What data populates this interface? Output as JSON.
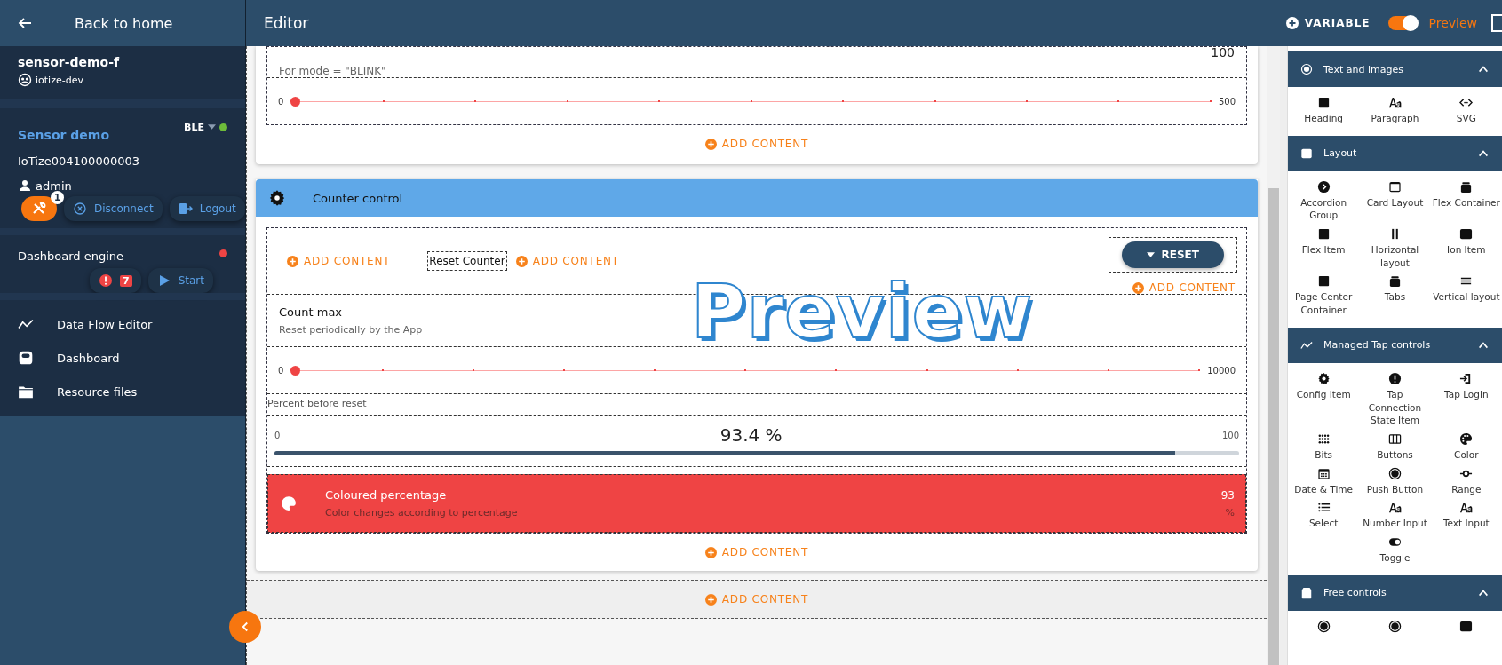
{
  "sidebar": {
    "back_label": "Back to home",
    "project": {
      "name": "sensor-demo-f",
      "organization": "iotize-dev"
    },
    "device": {
      "name": "Sensor demo",
      "protocol": "BLE",
      "connected": true,
      "serial": "IoTize004100000003",
      "user": "admin",
      "tools_badge": "1",
      "disconnect_label": "Disconnect",
      "logout_label": "Logout"
    },
    "engine": {
      "label": "Dashboard engine",
      "running": false,
      "error_count": "7",
      "start_label": "Start"
    },
    "nav": [
      {
        "kind": "chart",
        "label": "Data Flow Editor"
      },
      {
        "kind": "dashboard",
        "label": "Dashboard"
      },
      {
        "kind": "folder",
        "label": "Resource files"
      }
    ]
  },
  "header": {
    "title": "Editor",
    "variable_label": "VARIABLE",
    "preview_toggle": {
      "on": true,
      "label": "Preview"
    }
  },
  "editor": {
    "preview_overlay": "Preview",
    "top_card": {
      "subtitle": "For mode = \"BLINK\"",
      "value": "100",
      "slider": {
        "min": "0",
        "max": "500",
        "level": 0
      },
      "add_label": "ADD CONTENT"
    },
    "counter_card": {
      "title": "Counter control",
      "row": {
        "add_label_1": "ADD CONTENT",
        "text": "Reset Counter",
        "add_label_2": "ADD CONTENT",
        "button": "RESET",
        "button_add_label": "ADD CONTENT"
      },
      "count_max": {
        "title": "Count max",
        "description": "Reset periodically by the App",
        "slider": {
          "min": "0",
          "max": "10000",
          "level": 0
        }
      },
      "percent_label": "Percent before reset",
      "progress": {
        "min": "0",
        "max": "100",
        "reading": "93.4 %",
        "level": 0.934
      },
      "coloured": {
        "title": "Coloured percentage",
        "description": "Color changes according to percentage",
        "value": "93",
        "unit": "%"
      },
      "add_label": "ADD CONTENT"
    },
    "outer_add_label": "ADD CONTENT"
  },
  "panel": {
    "sections": [
      {
        "kind": "target",
        "title": "Text and images",
        "expanded": true,
        "items": [
          {
            "kind": "square",
            "label": "Heading"
          },
          {
            "kind": "aa",
            "label": "Paragraph"
          },
          {
            "kind": "code",
            "label": "SVG"
          }
        ]
      },
      {
        "kind": "card",
        "title": "Layout",
        "expanded": true,
        "items": [
          {
            "kind": "chevron",
            "label": "Accordion Group"
          },
          {
            "kind": "card",
            "label": "Card Layout"
          },
          {
            "kind": "stack",
            "label": "Flex Container"
          },
          {
            "kind": "square",
            "label": "Flex Item"
          },
          {
            "kind": "pause",
            "label": "Horizontal layout"
          },
          {
            "kind": "monitor",
            "label": "Ion Item"
          },
          {
            "kind": "square",
            "label": "Page Center Container"
          },
          {
            "kind": "stack",
            "label": "Tabs"
          },
          {
            "kind": "lines",
            "label": "Vertical layout"
          }
        ]
      },
      {
        "kind": "chart",
        "title": "Managed Tap controls",
        "expanded": true,
        "items": [
          {
            "kind": "gear",
            "label": "Config Item"
          },
          {
            "kind": "alert",
            "label": "Tap Connection State Item"
          },
          {
            "kind": "login",
            "label": "Tap Login"
          },
          {
            "kind": "dots",
            "label": "Bits"
          },
          {
            "kind": "columns",
            "label": "Buttons"
          },
          {
            "kind": "palette",
            "label": "Color"
          },
          {
            "kind": "calendar",
            "label": "Date & Time"
          },
          {
            "kind": "radio",
            "label": "Push Button"
          },
          {
            "kind": "range",
            "label": "Range"
          },
          {
            "kind": "list",
            "label": "Select"
          },
          {
            "kind": "aa",
            "label": "Number Input"
          },
          {
            "kind": "aa",
            "label": "Text Input"
          },
          {
            "kind": "toggle",
            "label": "Toggle"
          }
        ]
      },
      {
        "kind": "device",
        "title": "Free controls",
        "expanded": true,
        "items": [
          {
            "kind": "radio"
          },
          {
            "kind": "radio"
          },
          {
            "kind": "monitor"
          }
        ]
      }
    ]
  }
}
